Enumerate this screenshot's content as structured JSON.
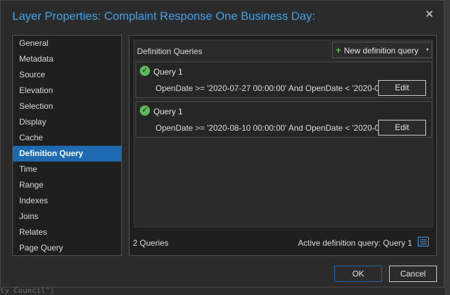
{
  "window": {
    "title": "Layer Properties: Complaint Response One Business Day:",
    "close_glyph": "✕"
  },
  "nav": {
    "items": [
      {
        "label": "General"
      },
      {
        "label": "Metadata"
      },
      {
        "label": "Source"
      },
      {
        "label": "Elevation"
      },
      {
        "label": "Selection"
      },
      {
        "label": "Display"
      },
      {
        "label": "Cache"
      },
      {
        "label": "Definition Query",
        "active": true
      },
      {
        "label": "Time"
      },
      {
        "label": "Range"
      },
      {
        "label": "Indexes"
      },
      {
        "label": "Joins"
      },
      {
        "label": "Relates"
      },
      {
        "label": "Page Query"
      }
    ]
  },
  "panel": {
    "section_label": "Definition Queries",
    "new_button": {
      "plus": "+",
      "label": "New definition query",
      "caret": "▾"
    },
    "queries": [
      {
        "name": "Query 1",
        "expression": "OpenDate >= '2020-07-27 00:00:00' And OpenDate < '2020-0...",
        "edit_label": "Edit",
        "status_icon": "check-circle-icon"
      },
      {
        "name": "Query 1",
        "expression": "OpenDate >= '2020-08-10 00:00:00' And OpenDate < '2020-0...",
        "edit_label": "Edit",
        "status_icon": "check-circle-icon"
      }
    ],
    "count_label": "2 Queries",
    "active_label": "Active definition query: Query 1"
  },
  "footer": {
    "ok_label": "OK",
    "cancel_label": "Cancel"
  },
  "background": {
    "code_fragment": "ty Council\")"
  },
  "colors": {
    "accent": "#1e6ab0",
    "title": "#45a1e8",
    "success": "#5bb85b"
  }
}
